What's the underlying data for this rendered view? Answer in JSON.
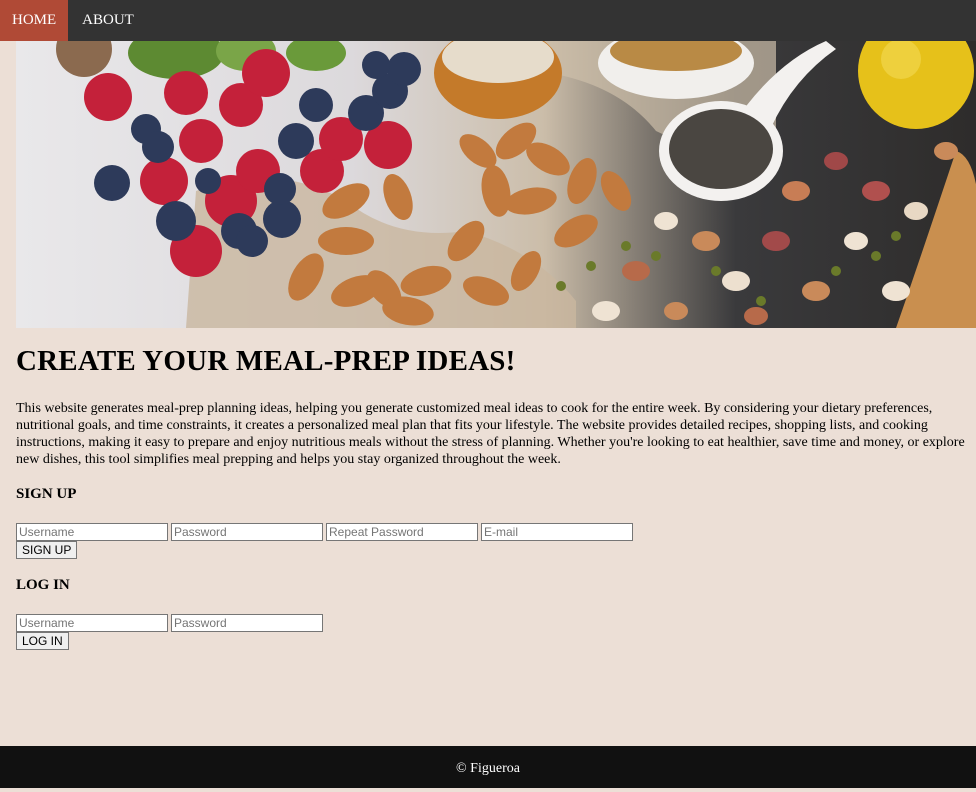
{
  "nav": {
    "home": "HOME",
    "about": "ABOUT"
  },
  "hero": {
    "image": "food-hero-image"
  },
  "main": {
    "title": "CREATE YOUR MEAL-PREP IDEAS!",
    "description": "This website generates meal-prep planning ideas, helping you generate customized meal ideas to cook for the entire week. By considering your dietary preferences, nutritional goals, and time constraints, it creates a personalized meal plan that fits your lifestyle. The website provides detailed recipes, shopping lists, and cooking instructions, making it easy to prepare and enjoy nutritious meals without the stress of planning. Whether you're looking to eat healthier, save time and money, or explore new dishes, this tool simplifies meal prepping and helps you stay organized throughout the week."
  },
  "signup": {
    "heading": "SIGN UP",
    "username_placeholder": "Username",
    "password_placeholder": "Password",
    "repeat_password_placeholder": "Repeat Password",
    "email_placeholder": "E-mail",
    "button": "SIGN UP"
  },
  "login": {
    "heading": "LOG IN",
    "username_placeholder": "Username",
    "password_placeholder": "Password",
    "button": "LOG IN"
  },
  "footer": {
    "text": "© Figueroa"
  },
  "colors": {
    "nav_bg": "#333333",
    "nav_active": "#b04a36",
    "page_bg": "#ecdfd6",
    "footer_bg": "#111111"
  }
}
